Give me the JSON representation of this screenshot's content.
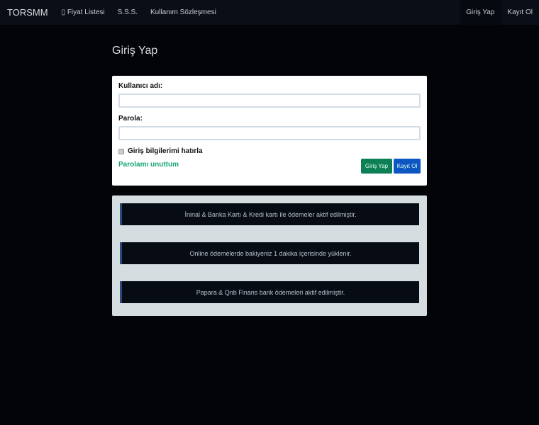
{
  "nav": {
    "brand": "TORSMM",
    "items": [
      "▯ Fiyat Listesi",
      "S.S.S.",
      "Kullanım Sözleşmesi"
    ],
    "right": [
      "Giriş Yap",
      "Kayıt Ol"
    ]
  },
  "title": "Giriş Yap",
  "form": {
    "username_label": "Kullanıcı adı:",
    "password_label": "Parola:",
    "remember": "Giriş bilgilerimi hatırla",
    "forgot": "Parolamı unuttum",
    "login": "Giriş Yap",
    "register": "Kayıt Ol"
  },
  "notes": [
    "İninal & Banka Kartı & Kredi kartı ile ödemeler aktif edilmiştir.",
    "Online ödemelerde bakiyeniz 1 dakika içerisinde yüklenir.",
    "Papara & Qnb Finans bank ödemeleri aktif edilmiştir."
  ]
}
